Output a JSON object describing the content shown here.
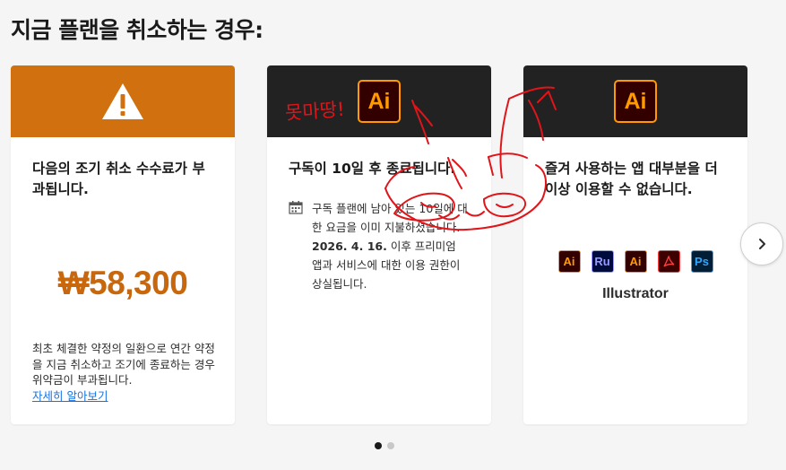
{
  "page": {
    "title": "지금 플랜을 취소하는 경우:"
  },
  "cards": [
    {
      "header_color": "#d0700e",
      "icon": "warning-icon",
      "heading": "다음의 조기 취소 수수료가 부과됩니다.",
      "price": "₩58,300",
      "fine_print": "최초 체결한 약정의 일환으로 연간 약정을 지금 취소하고 조기에 종료하는 경우 위약금이 부과됩니다.",
      "link": "자세히 알아보기"
    },
    {
      "header_color": "#222222",
      "icon": "illustrator-icon",
      "icon_text": "Ai",
      "heading": "구독이 10일 후 종료됩니다.",
      "info_line1": "구독 플랜에 남아 있는 10일에 대한 요금을 이미 지불하셨습니다.",
      "info_date": "2026. 4. 16.",
      "info_line2": " 이후 프리미엄 앱과 서비스에 대한 이용 권한이 상실됩니다."
    },
    {
      "header_color": "#222222",
      "icon": "illustrator-icon",
      "icon_text": "Ai",
      "heading": "즐겨 사용하는 앱 대부분을 더 이상 이용할 수 없습니다.",
      "apps": [
        {
          "name": "illustrator-icon",
          "label": "Ai",
          "bg": "#330000",
          "fg": "#ff9a00"
        },
        {
          "name": "rush-icon",
          "label": "Ru",
          "bg": "#000b3d",
          "fg": "#9999ff"
        },
        {
          "name": "illustrator-icon",
          "label": "Ai",
          "bg": "#330000",
          "fg": "#ff9a00"
        },
        {
          "name": "acrobat-icon",
          "label": "",
          "bg": "#3d0000",
          "fg": "#ff4040"
        },
        {
          "name": "photoshop-icon",
          "label": "Ps",
          "bg": "#001e36",
          "fg": "#31a8ff"
        }
      ],
      "app_caption": "Illustrator"
    }
  ],
  "carousel": {
    "next_icon": "chevron-right-icon",
    "pages": 2,
    "active_page": 1
  },
  "annotation": {
    "text": "못마땅!",
    "color": "#e0151a"
  }
}
